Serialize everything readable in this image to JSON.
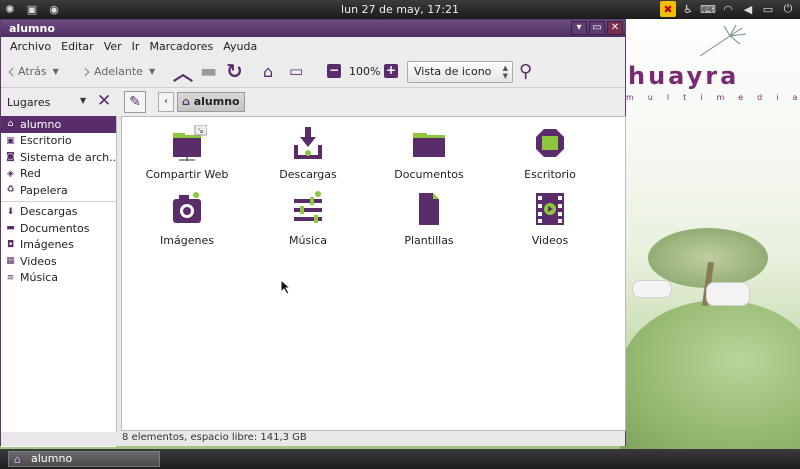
{
  "top_panel": {
    "clock": "lun 27 de may, 17:21"
  },
  "window": {
    "title": "alumno"
  },
  "menu": [
    "Archivo",
    "Editar",
    "Ver",
    "Ir",
    "Marcadores",
    "Ayuda"
  ],
  "toolbar": {
    "back": "Atrás",
    "forward": "Adelante",
    "zoom": "100%",
    "view_mode": "Vista de icono"
  },
  "location": {
    "places_label": "Lugares",
    "crumb": "alumno"
  },
  "sidebar": {
    "items": [
      {
        "label": "alumno",
        "icon": "home-icon"
      },
      {
        "label": "Escritorio",
        "icon": "desktop-icon"
      },
      {
        "label": "Sistema de arch...",
        "icon": "filesystem-icon"
      },
      {
        "label": "Red",
        "icon": "network-icon"
      },
      {
        "label": "Papelera",
        "icon": "trash-icon"
      },
      {
        "label": "Descargas",
        "icon": "downloads-icon"
      },
      {
        "label": "Documentos",
        "icon": "documents-icon"
      },
      {
        "label": "Imágenes",
        "icon": "pictures-icon"
      },
      {
        "label": "Videos",
        "icon": "videos-icon"
      },
      {
        "label": "Música",
        "icon": "music-icon"
      }
    ]
  },
  "files": [
    {
      "label": "Compartir Web"
    },
    {
      "label": "Descargas"
    },
    {
      "label": "Documentos"
    },
    {
      "label": "Escritorio"
    },
    {
      "label": "Imágenes"
    },
    {
      "label": "Música"
    },
    {
      "label": "Plantillas"
    },
    {
      "label": "Videos"
    }
  ],
  "status": "8 elementos, espacio libre: 141,3 GB",
  "taskbar": {
    "task_label": "alumno"
  },
  "desktop": {
    "brand": "huayra",
    "brand_sub": "multimedia"
  },
  "colors": {
    "accent": "#5a2d6a",
    "green": "#8dc63f"
  }
}
